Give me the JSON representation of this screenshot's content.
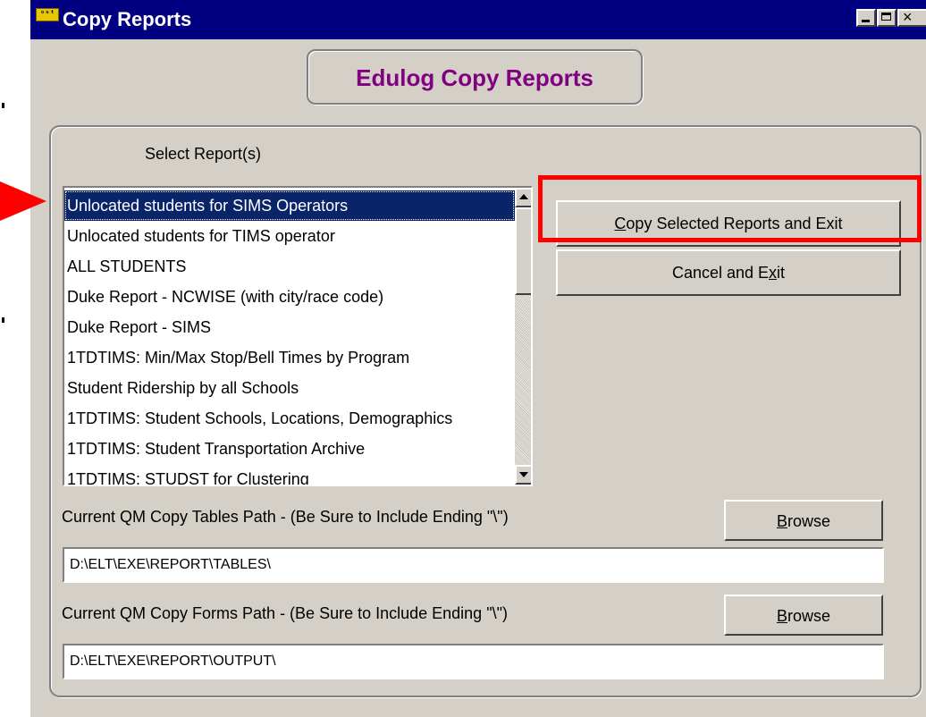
{
  "window": {
    "app_icon_text": "()",
    "title": "Copy Reports",
    "controls": {
      "minimize": "minimize-icon",
      "maximize": "maximize-icon",
      "close": "close-icon"
    }
  },
  "header": {
    "title": "Edulog Copy Reports"
  },
  "reports": {
    "label": "Select Report(s)",
    "items": [
      "Unlocated students for SIMS Operators",
      "Unlocated students for TIMS operator",
      "ALL STUDENTS",
      "Duke Report - NCWISE (with city/race code)",
      "Duke Report - SIMS",
      "1TDTIMS: Min/Max Stop/Bell Times by Program",
      "Student Ridership by all Schools",
      "1TDTIMS: Student Schools, Locations, Demographics",
      "1TDTIMS: Student Transportation Archive",
      "1TDTIMS:  STUDST for Clustering"
    ],
    "selected_index": 0
  },
  "buttons": {
    "copy_hotkey": "C",
    "copy_rest": "opy Selected Reports and Exit",
    "cancel_pre": "Cancel and E",
    "cancel_hotkey": "x",
    "cancel_post": "it",
    "browse_hotkey": "B",
    "browse_rest": "rowse"
  },
  "tables_path": {
    "label": "Current QM Copy Tables Path - (Be Sure to Include Ending \"\\\")",
    "value": "D:\\ELT\\EXE\\REPORT\\TABLES\\"
  },
  "forms_path": {
    "label": "Current QM Copy Forms Path - (Be Sure to Include Ending \"\\\")",
    "value": "D:\\ELT\\EXE\\REPORT\\OUTPUT\\"
  },
  "colors": {
    "title_bar": "#000080",
    "header_text": "#800080",
    "selection": "#0a246a",
    "highlight": "#ff0000",
    "face": "#d4d0c8"
  }
}
